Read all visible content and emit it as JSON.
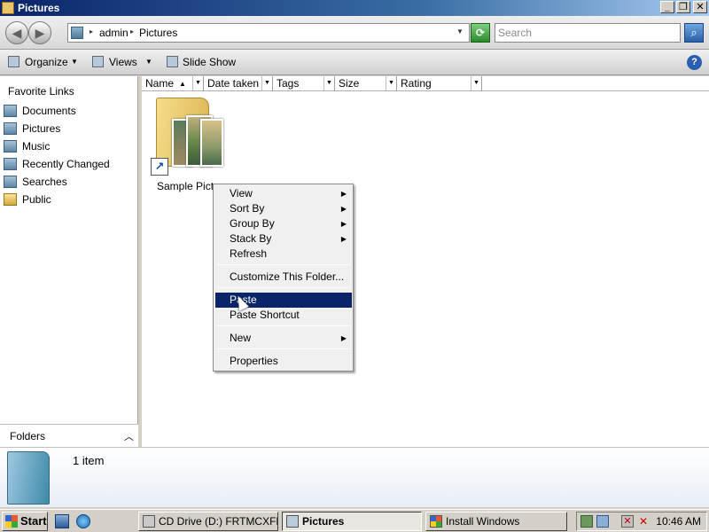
{
  "window": {
    "title": "Pictures",
    "min": "_",
    "max": "❐",
    "close": "✕"
  },
  "address": {
    "crumbs": [
      "admin",
      "Pictures"
    ],
    "search_placeholder": "Search"
  },
  "toolbar": {
    "organize": "Organize",
    "views": "Views",
    "slideshow": "Slide Show",
    "help": "?"
  },
  "sidebar": {
    "title": "Favorite Links",
    "items": [
      {
        "label": "Documents",
        "icon": "documents-icon"
      },
      {
        "label": "Pictures",
        "icon": "pictures-icon"
      },
      {
        "label": "Music",
        "icon": "music-icon"
      },
      {
        "label": "Recently Changed",
        "icon": "recent-icon"
      },
      {
        "label": "Searches",
        "icon": "searches-icon"
      },
      {
        "label": "Public",
        "icon": "folder-icon"
      }
    ],
    "folders": "Folders"
  },
  "columns": [
    "Name",
    "Date taken",
    "Tags",
    "Size",
    "Rating"
  ],
  "files": [
    {
      "label": "Sample Pictures"
    }
  ],
  "context_menu": {
    "items": [
      {
        "label": "View",
        "submenu": true
      },
      {
        "label": "Sort By",
        "submenu": true
      },
      {
        "label": "Group By",
        "submenu": true
      },
      {
        "label": "Stack By",
        "submenu": true
      },
      {
        "label": "Refresh",
        "submenu": false
      },
      {
        "label": "Customize This Folder...",
        "submenu": false
      },
      {
        "label": "Paste",
        "submenu": false,
        "selected": true
      },
      {
        "label": "Paste Shortcut",
        "submenu": false
      },
      {
        "label": "New",
        "submenu": true
      },
      {
        "label": "Properties",
        "submenu": false
      }
    ]
  },
  "details": {
    "count": "1 item"
  },
  "taskbar": {
    "start": "Start",
    "buttons": [
      {
        "label": "CD Drive (D:) FRTMCXFR...",
        "active": false
      },
      {
        "label": "Pictures",
        "active": true
      },
      {
        "label": "Install Windows",
        "active": false
      }
    ],
    "clock": "10:46 AM"
  },
  "colors": {
    "title_gradient_start": "#0a246a",
    "menu_highlight": "#0a246a"
  }
}
